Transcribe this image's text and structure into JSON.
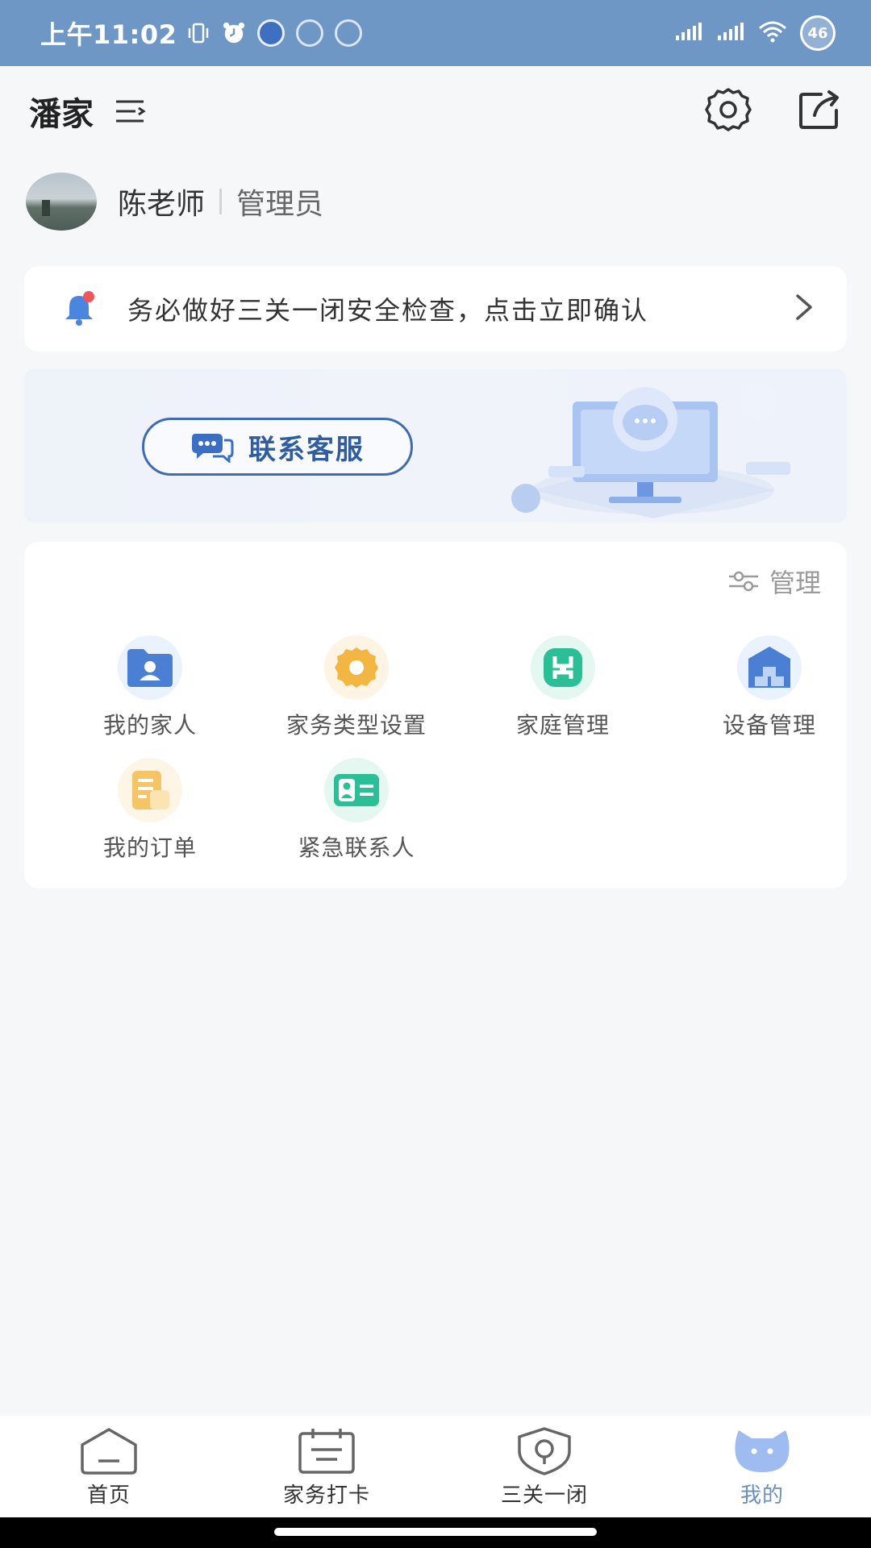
{
  "status_bar": {
    "time": "上午11:02",
    "left_icons": [
      "vibrate-icon",
      "alarm-icon",
      "info-app-icon",
      "shield-app-icon",
      "home-app-icon"
    ],
    "right_icons": [
      "signal-icon",
      "signal-icon",
      "wifi-icon"
    ],
    "battery": "46"
  },
  "header": {
    "title": "潘家",
    "switch_icon": "switch-home-icon",
    "settings_icon": "gear-icon",
    "share_icon": "share-icon"
  },
  "profile": {
    "name": "陈老师",
    "role": "管理员"
  },
  "notice": {
    "text": "务必做好三关一闭安全检查，点击立即确认"
  },
  "banner": {
    "button_label": "联系客服"
  },
  "panel": {
    "manage_label": "管理",
    "items": [
      {
        "label": "我的家人",
        "icon": "family-icon",
        "color": "#4a7fd4"
      },
      {
        "label": "家务类型设置",
        "icon": "gear-icon",
        "color": "#f3b642"
      },
      {
        "label": "家庭管理",
        "icon": "home-manage-icon",
        "color": "#2bbf97"
      },
      {
        "label": "设备管理",
        "icon": "device-icon",
        "color": "#4a7fd4"
      },
      {
        "label": "我的订单",
        "icon": "order-icon",
        "color": "#f5c466"
      },
      {
        "label": "紧急联系人",
        "icon": "contact-card-icon",
        "color": "#2bbf97"
      }
    ]
  },
  "tabbar": {
    "tabs": [
      {
        "label": "首页",
        "icon": "home-icon"
      },
      {
        "label": "家务打卡",
        "icon": "calendar-icon"
      },
      {
        "label": "三关一闭",
        "icon": "shield-icon"
      },
      {
        "label": "我的",
        "icon": "cat-icon"
      }
    ],
    "active_index": 3,
    "active_color": "#6a8fc0"
  }
}
